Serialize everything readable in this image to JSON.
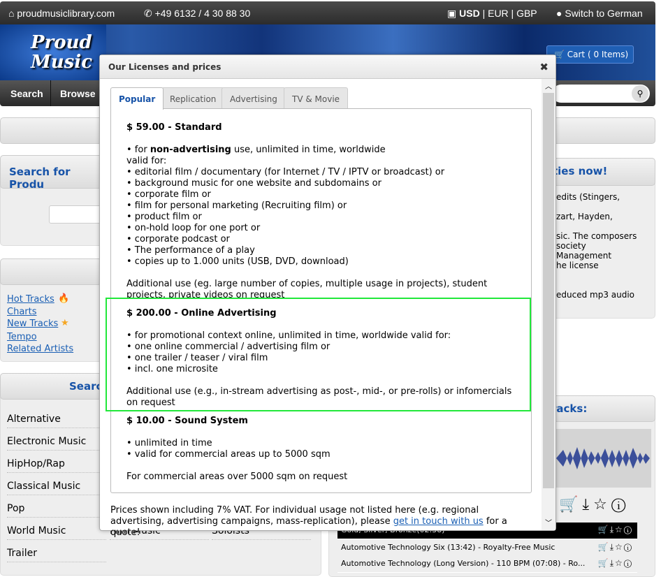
{
  "topbar": {
    "site": "proudmusiclibrary.com",
    "phone": "+49 6132 / 4 30 88 30",
    "currency_active": "USD",
    "currency_rest": "| EUR | GBP",
    "language": "Switch to German"
  },
  "banner": {
    "logo_line1": "Proud",
    "logo_line2": "Music",
    "cart": "Cart ( 0 Items)"
  },
  "nav": {
    "items": [
      "Search",
      "Browse"
    ]
  },
  "left": {
    "search_heading": "Search for Produ",
    "links": [
      "Hot Tracks",
      "Charts",
      "New Tracks",
      "Tempo",
      "Related Artists"
    ],
    "genre_heading": "Searc",
    "genres": [
      "Alternative",
      "Electronic Music",
      "HipHop/Rap",
      "Classical Music",
      "Pop",
      "World Music",
      "Trailer"
    ],
    "genres_col2": [
      "Film Music",
      "Soloists"
    ]
  },
  "right": {
    "heading": "ties now!",
    "texts": [
      "edits (Stingers,",
      "zart, Hayden,",
      "sic. The composers",
      "society",
      "Management",
      "he license",
      "educed mp3 audio"
    ],
    "tracks_heading": "racks:",
    "tracks": [
      "Gold, Silver, Bronze(02:38)",
      "Automotive Technology Six (13:42) - Royalty-Free Music",
      "Automotive Technology (Long Version) - 110 BPM (07:08) - Ro..."
    ]
  },
  "modal": {
    "title": "Our Licenses and prices",
    "tabs": [
      "Popular",
      "Replication",
      "Advertising",
      "TV & Movie"
    ],
    "active_tab": "Popular",
    "standard": {
      "price": "$ 59.00",
      "name": " - Standard",
      "intro_pre": "• for ",
      "intro_bold": "non-advertising",
      "intro_post": " use, unlimited in time, worldwide",
      "items": [
        "valid for:",
        "• editorial film / documentary (for Internet / TV / IPTV or broadcast) or",
        "• background music for one website and subdomains or",
        "• corporate film or",
        "• film for personal marketing (Recruiting film) or",
        "• product film or",
        "• on-hold loop for one port or",
        "• corporate podcast or",
        "• The performance of a play",
        "• copies up to 1.000 units (USB, DVD, download)"
      ],
      "additional": "Additional use (eg. large number of copies, multiple usage in projects), student projects, private videos on request"
    },
    "online": {
      "price": "$ 200.00",
      "name": " - Online Advertising",
      "items": [
        "• for promotional context online, unlimited in time, worldwide valid for:",
        "• one online commercial / advertising film or",
        "• one trailer / teaser / viral film",
        "• incl. one microsite"
      ],
      "additional": "Additional use (e.g., in-stream advertising as post-, mid-, or pre-rolls) or infomercials on request"
    },
    "sound": {
      "price": "$ 10.00",
      "name": " - Sound System",
      "items": [
        "• unlimited in time",
        "• valid for commercial areas up to 5000 sqm"
      ],
      "additional": "For commercial areas over 5000 sqm on request"
    },
    "footer_pre": "Prices shown including 7% VAT. For individual usage not listed here (e.g. regional advertising, advertising campaigns, mass-replication), please ",
    "footer_link": "get in touch with us",
    "footer_post": " for a quote!"
  },
  "colors": {
    "accent": "#1753a8",
    "highlight": "#21e83a"
  }
}
